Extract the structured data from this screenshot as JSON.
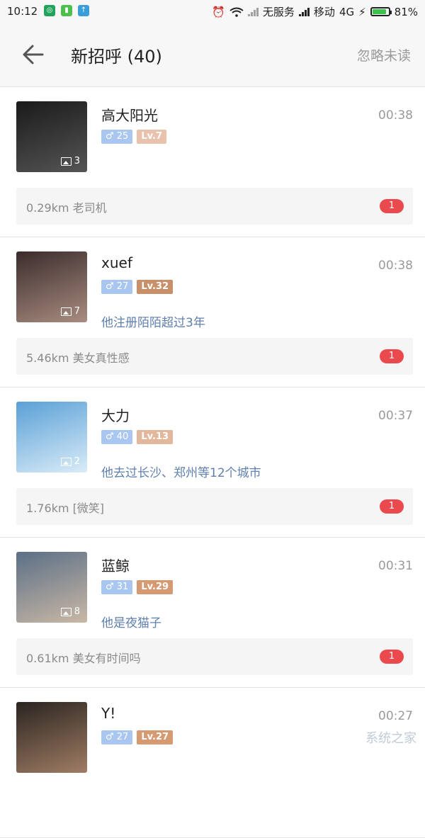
{
  "status_bar": {
    "time": "10:12",
    "carrier_none": "无服务",
    "carrier": "移动",
    "network": "4G",
    "battery": "81%",
    "battery_level": 0.81
  },
  "header": {
    "title": "新招呼 (40)",
    "ignore_unread": "忽略未读"
  },
  "messages": [
    {
      "name": "高大阳光",
      "time": "00:38",
      "gender_age": "♂ 25",
      "level": "Lv.7",
      "level_color": "#e8c2ad",
      "photo_count": "3",
      "tagline": "",
      "message": "0.29km 老司机",
      "unread": "1",
      "avatar_colors": [
        "#1a1a1a",
        "#555555"
      ]
    },
    {
      "name": "xuef",
      "time": "00:38",
      "gender_age": "♂ 27",
      "level": "Lv.32",
      "level_color": "#c8906a",
      "photo_count": "7",
      "tagline": "他注册陌陌超过3年",
      "message": "5.46km 美女真性感",
      "unread": "1",
      "avatar_colors": [
        "#3a2c2c",
        "#a98c80"
      ]
    },
    {
      "name": "大力",
      "time": "00:37",
      "gender_age": "♂ 40",
      "level": "Lv.13",
      "level_color": "#e3b79b",
      "photo_count": "2",
      "tagline": "他去过长沙、郑州等12个城市",
      "message": "1.76km [微笑]",
      "unread": "1",
      "avatar_colors": [
        "#5aa0d6",
        "#d9ecf8"
      ]
    },
    {
      "name": "蓝鲸",
      "time": "00:31",
      "gender_age": "♂ 31",
      "level": "Lv.29",
      "level_color": "#d69a72",
      "photo_count": "8",
      "tagline": "他是夜猫子",
      "message": "0.61km 美女有时间吗",
      "unread": "1",
      "avatar_colors": [
        "#5b6f86",
        "#c9b8a6"
      ]
    },
    {
      "name": "Y!",
      "time": "00:27",
      "gender_age": "♂ 27",
      "level": "Lv.27",
      "level_color": "#d69a72",
      "photo_count": "",
      "tagline": "",
      "message": "",
      "unread": "",
      "avatar_colors": [
        "#2a2420",
        "#a07d64"
      ]
    }
  ],
  "watermark": "系统之家"
}
